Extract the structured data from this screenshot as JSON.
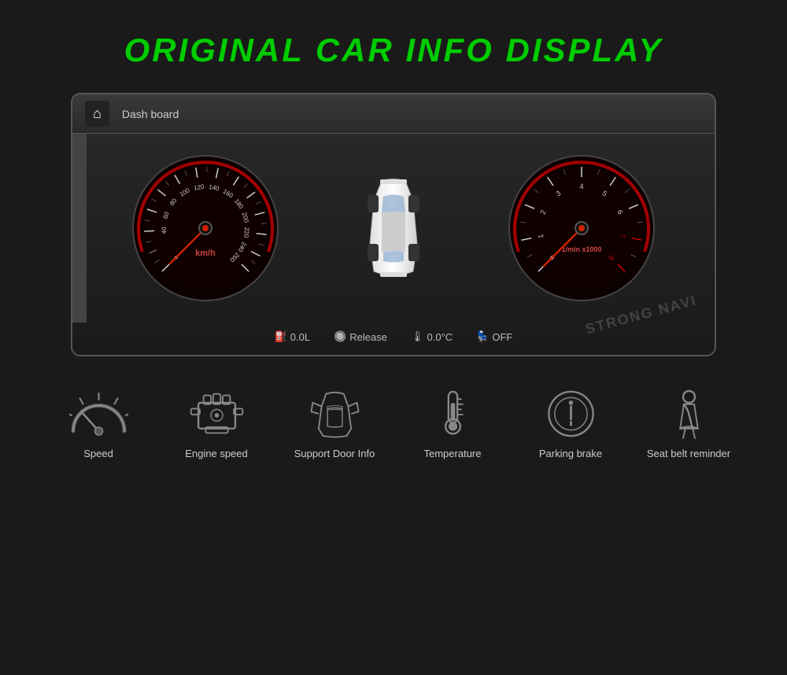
{
  "page": {
    "title": "ORIGINAL CAR INFO DISPLAY",
    "background": "#1a1a1a"
  },
  "dashboard": {
    "header": {
      "title": "Dash board"
    },
    "status_items": [
      {
        "icon": "fuel-icon",
        "value": "0.0L"
      },
      {
        "icon": "pressure-icon",
        "value": "Release"
      },
      {
        "icon": "temp-icon",
        "value": "0.0°C"
      },
      {
        "icon": "seatbelt-icon",
        "value": "OFF"
      }
    ],
    "watermark": "STRONG NAVI",
    "speedometer": {
      "label": "km/h",
      "max": 260,
      "current": 0
    },
    "tachometer": {
      "label": "1/min x1000",
      "max": 8,
      "current": 0
    }
  },
  "features": [
    {
      "id": "speed",
      "label": "Speed",
      "icon": "speedometer-icon"
    },
    {
      "id": "engine-speed",
      "label": "Engine speed",
      "icon": "engine-icon"
    },
    {
      "id": "door-info",
      "label": "Support Door Info",
      "icon": "door-icon"
    },
    {
      "id": "temperature",
      "label": "Temperature",
      "icon": "thermometer-icon"
    },
    {
      "id": "parking-brake",
      "label": "Parking brake",
      "icon": "parking-brake-icon"
    },
    {
      "id": "seatbelt",
      "label": "Seat belt reminder",
      "icon": "seatbelt-reminder-icon"
    }
  ]
}
